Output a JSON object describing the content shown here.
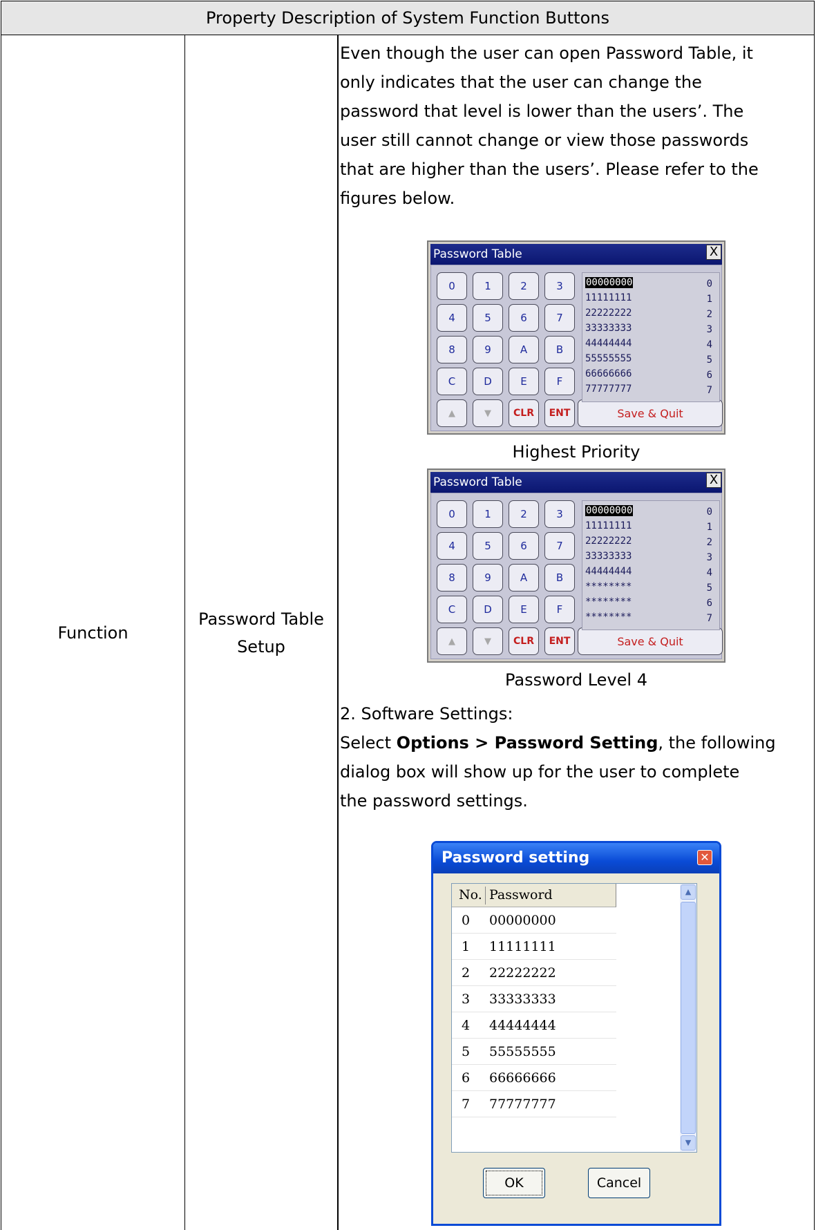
{
  "header": {
    "title": "Property Description of System Function Buttons"
  },
  "columns": {
    "category": "Function",
    "item_line1": "Password Table",
    "item_line2": "Setup"
  },
  "description": {
    "paragraph1": [
      "Even though the user can open Password Table, it",
      "only indicates that the user can change the",
      "password that level is lower than the users’. The",
      "user still cannot change or view those passwords",
      "that are higher than the users’. Please refer to the",
      "figures below."
    ],
    "caption1": "Highest Priority",
    "caption2": "Password Level 4",
    "section2": "2. Software Settings:",
    "select_prefix": "Select ",
    "menu_options": "Options",
    "menu_sep": " > ",
    "menu_password": "Password Setting",
    "select_suffix": ", the following",
    "line_dialog": "dialog box will show up for the user to complete",
    "line_settings": "the password settings."
  },
  "panel": {
    "title": "Password Table",
    "close": "X",
    "keys": [
      "0",
      "1",
      "2",
      "3",
      "4",
      "5",
      "6",
      "7",
      "8",
      "9",
      "A",
      "B",
      "C",
      "D",
      "E",
      "F"
    ],
    "up": "▲",
    "down": "▼",
    "clr": "CLR",
    "ent": "ENT",
    "save": "Save & Quit",
    "numbers": [
      "0",
      "1",
      "2",
      "3",
      "4",
      "5",
      "6",
      "7"
    ],
    "list_highest": [
      "00000000",
      "11111111",
      "22222222",
      "33333333",
      "44444444",
      "55555555",
      "66666666",
      "77777777"
    ],
    "list_level4": [
      "00000000",
      "11111111",
      "22222222",
      "33333333",
      "44444444",
      "********",
      "********",
      "********"
    ]
  },
  "dialog": {
    "title": "Password setting",
    "close": "✕",
    "col_no": "No.",
    "col_password": "Password",
    "rows": [
      {
        "no": "0",
        "pw": "00000000"
      },
      {
        "no": "1",
        "pw": "11111111"
      },
      {
        "no": "2",
        "pw": "22222222"
      },
      {
        "no": "3",
        "pw": "33333333"
      },
      {
        "no": "4",
        "pw": "44444444"
      },
      {
        "no": "5",
        "pw": "55555555"
      },
      {
        "no": "6",
        "pw": "66666666"
      },
      {
        "no": "7",
        "pw": "77777777"
      }
    ],
    "scroll_up": "▲",
    "scroll_down": "▼",
    "ok": "OK",
    "cancel": "Cancel"
  }
}
